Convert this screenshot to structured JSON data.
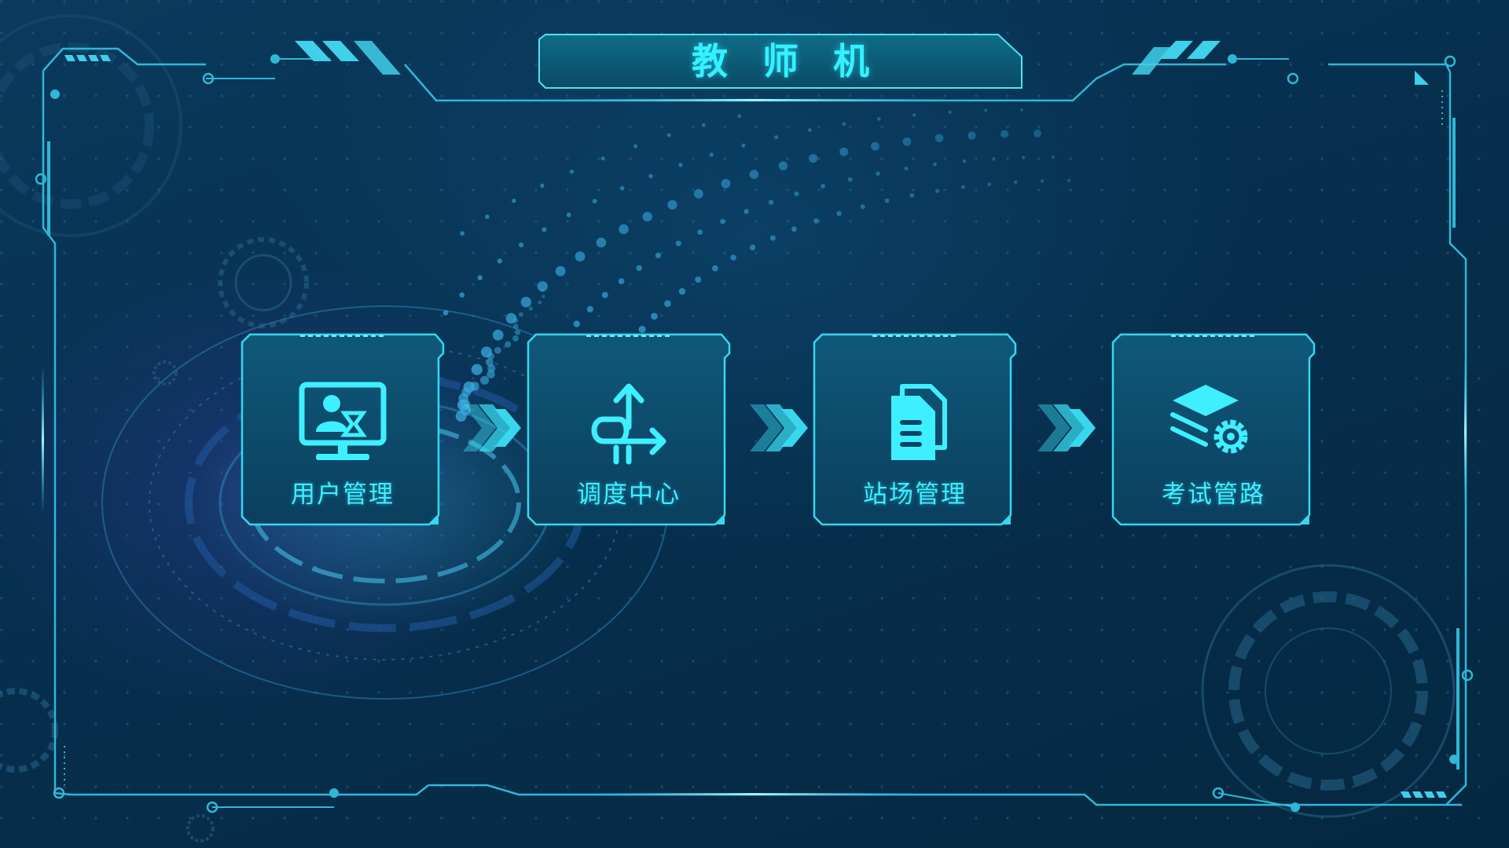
{
  "header": {
    "title": "教师机"
  },
  "cards": [
    {
      "label": "用户管理",
      "icon": "user-monitor-icon"
    },
    {
      "label": "调度中心",
      "icon": "dispatch-arrows-icon"
    },
    {
      "label": "站场管理",
      "icon": "documents-icon"
    },
    {
      "label": "考试管路",
      "icon": "layers-gear-icon"
    }
  ],
  "flow_arrows": [
    "chevron-right-icon",
    "chevron-right-icon",
    "chevron-right-icon"
  ],
  "colors": {
    "accent": "#35f1ff",
    "frame": "#2fb8d6",
    "background": "#062a48",
    "card_fill": "#0d4a6b"
  }
}
